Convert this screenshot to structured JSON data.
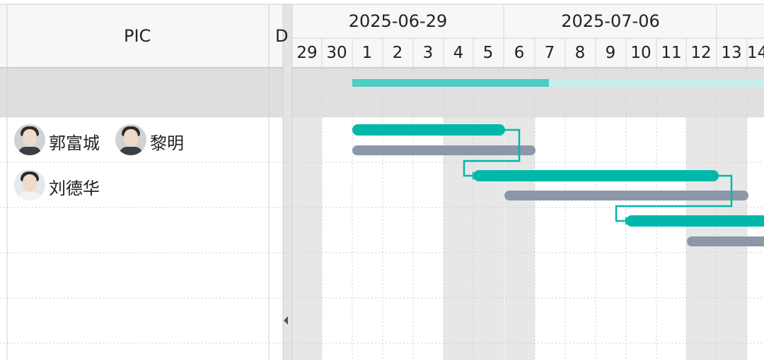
{
  "left_panel": {
    "pic_header": "PIC",
    "next_header_fragment": "D",
    "rows": [
      {
        "people": []
      },
      {
        "people": [
          {
            "name": "郭富城"
          },
          {
            "name": "黎明"
          }
        ]
      },
      {
        "people": [
          {
            "name": "刘德华"
          }
        ]
      },
      {
        "people": []
      },
      {
        "people": []
      },
      {
        "people": []
      }
    ]
  },
  "timeline": {
    "weeks": [
      "2025-06-29",
      "2025-07-06"
    ],
    "days": [
      "29",
      "30",
      "1",
      "2",
      "3",
      "4",
      "5",
      "6",
      "7",
      "8",
      "9",
      "10",
      "11",
      "12",
      "13",
      "14"
    ],
    "colors": {
      "actual_bar": "#00b8a9",
      "planned_bar": "#8c97a8",
      "summary_progress": "#4ecdc4",
      "summary_rest": "#c9efec",
      "weekend_shade": "#e6e6e6",
      "header_bg": "#f5f5f5"
    }
  }
}
